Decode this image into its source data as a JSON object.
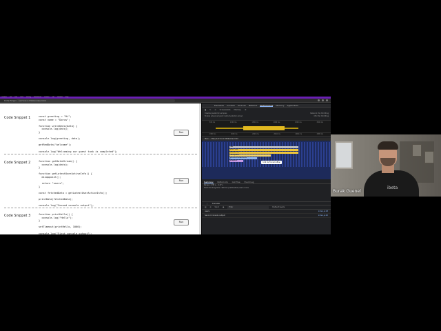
{
  "menubar": {
    "items": [
      "Chrome",
      "File",
      "Edit",
      "View",
      "History",
      "Bookmarks",
      "Profiles",
      "Tab",
      "Window",
      "Help"
    ]
  },
  "browser": {
    "tab_title": "Code Snippets",
    "url": "127.0.0.1:5500/index.html"
  },
  "snippets": [
    {
      "title": "Code Snippet 1",
      "code": "const greeting = \"Hi\";\nconst name = \"Dorus\";\n\nfunction writeData(data) {\n  console.log(data);\n}\n\nconsole.log(greeting, data);\n\ngetRedData(\"welcome\");\n\nconsole.log(\"Welcoming our guest task is completed\");",
      "button": "Run"
    },
    {
      "title": "Code Snippet 2",
      "code": "function getDataStream() {\n  console.log(data);\n}\n\nfunction getLatestUserActiveInfo() {\n  disappoint();\n\n  return \"users\";\n}\n\nconst fetchedData = getLatestUserActiveInfo();\n\nprintData(fetchedData);\n\nconsole.log(\"Second console output\");",
      "button": "Run"
    },
    {
      "title": "Code Snippet 3",
      "code": "function printHello() {\n  console.log(\"Hello\");\n}\n\nsetTimeout(printHello, 1000);\n\nconsole.log(\"First console output\");",
      "button": "Run"
    }
  ],
  "devtools": {
    "tabs": [
      "Elements",
      "Console",
      "Sources",
      "Network",
      "Performance",
      "Memory",
      "Application"
    ],
    "active_tab": "Performance",
    "toolbar": [
      "Screenshots",
      "Memory"
    ],
    "options": {
      "left1": "Disable JavaScript samples",
      "left2": "Enable advanced paint instrumentation (slow)",
      "right1": "Network: No throttling",
      "right2": "CPU: No throttling"
    },
    "overview_ticks": [
      "500 ms",
      "1000 ms",
      "1500 ms",
      "2000 ms",
      "2500 ms",
      "3000 ms"
    ],
    "ruler_ticks": [
      "1980 ms",
      "2000 ms",
      "2020 ms",
      "2040 ms",
      "2060 ms",
      "2080 ms"
    ],
    "flame_header": "Main — http://127.0.0.1:5500/index.html",
    "flame_blocks": [
      "Task",
      "Event: click",
      "Function Call",
      "(anonymous)",
      "getLatestUserActiveInfo",
      "disappoint"
    ],
    "tooltip": "3.16 ms  Forced reflow",
    "summary_tabs": [
      "Summary",
      "Bottom-Up",
      "Call Tree",
      "Event Log"
    ],
    "summary_active": "Summary",
    "summary_range": "Range: 2.38 s – 2.47 s",
    "summary_detail": "Total blocking time: 306 ms (estimated)  Learn more",
    "console_tabs": [
      "Console"
    ],
    "console_filter_placeholder": "Filter",
    "console_levels": "Default levels",
    "console_rows": [
      {
        "text": "users",
        "src": "index.js:18"
      },
      {
        "text": "Second console output",
        "src": "index.js:20"
      }
    ]
  },
  "webcam": {
    "name": "Burak Guenel",
    "logo": "ibeta"
  },
  "colors": {
    "menubar": "#6a1fb4",
    "devtools_bg": "#202124",
    "flame_bg": "#1d2a5a",
    "overview_yellow": "#e2b920"
  }
}
